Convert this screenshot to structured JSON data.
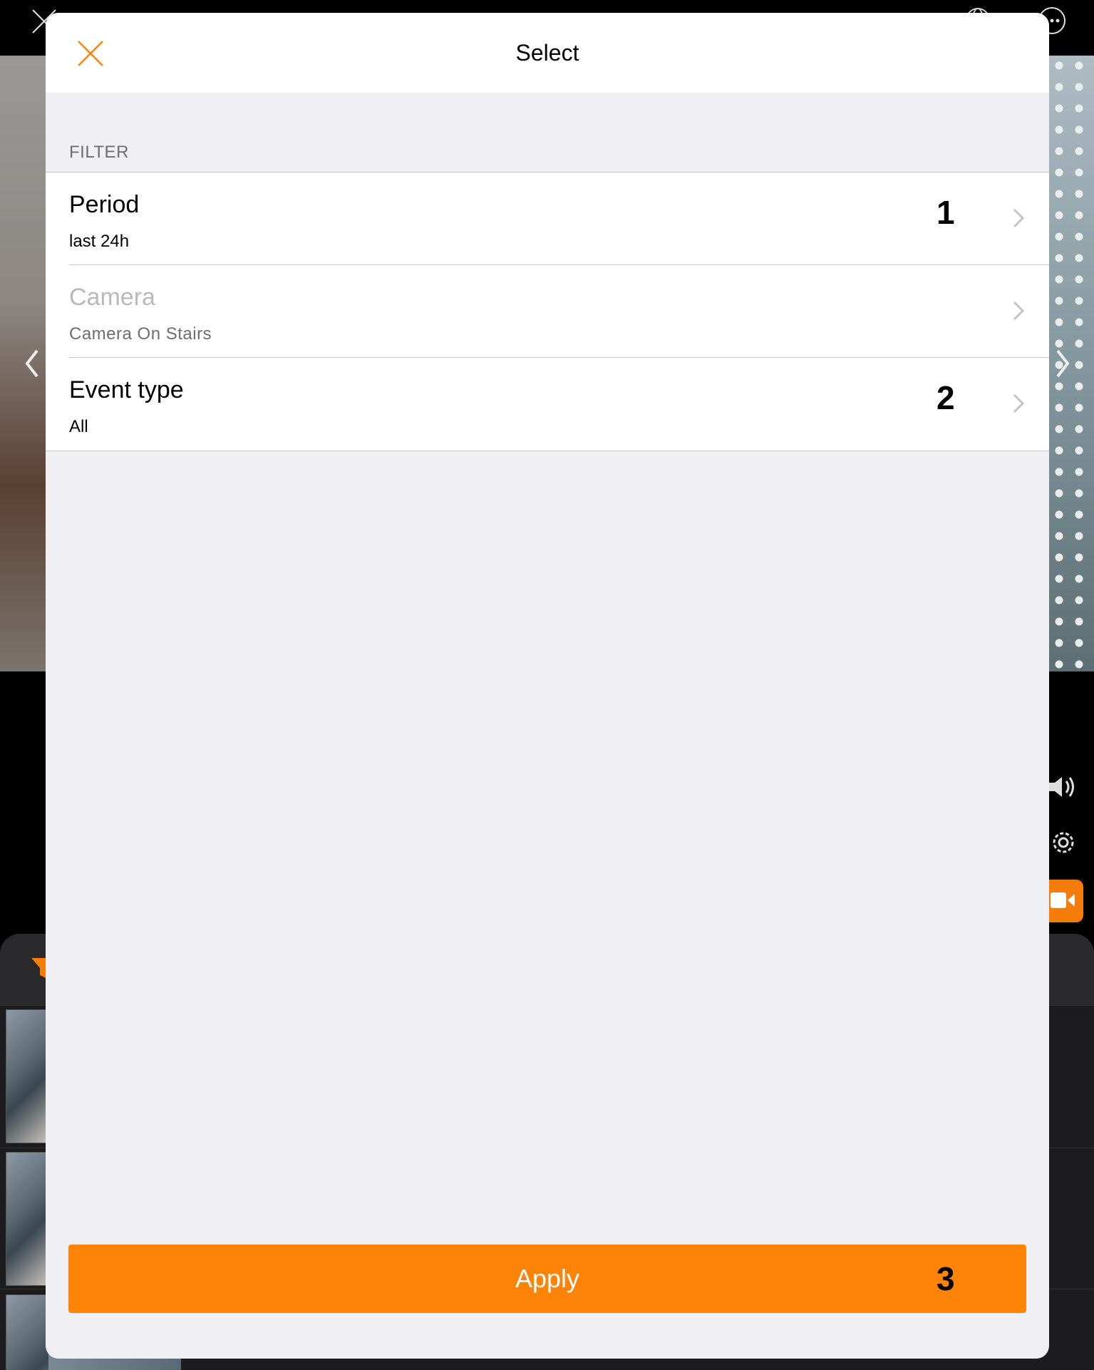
{
  "modal": {
    "title": "Select",
    "section_label": "FILTER",
    "rows": [
      {
        "title": "Period",
        "value": "last 24h",
        "badge": "1",
        "enabled": true
      },
      {
        "title": "Camera",
        "value": "Camera On Stairs",
        "badge": "",
        "enabled": false
      },
      {
        "title": "Event type",
        "value": "All",
        "badge": "2",
        "enabled": true
      }
    ],
    "apply": {
      "label": "Apply",
      "badge": "3"
    }
  },
  "colors": {
    "accent": "#fd8309",
    "modal_background": "#efeff4",
    "disabled_text": "#b9b9bd"
  },
  "icons": {
    "close": "close-icon",
    "chevron": "chevron-right-icon",
    "background_controls": [
      "globe-icon",
      "more-icon",
      "speaker-icon",
      "gear-icon",
      "video-camera-icon",
      "filter-icon"
    ]
  }
}
